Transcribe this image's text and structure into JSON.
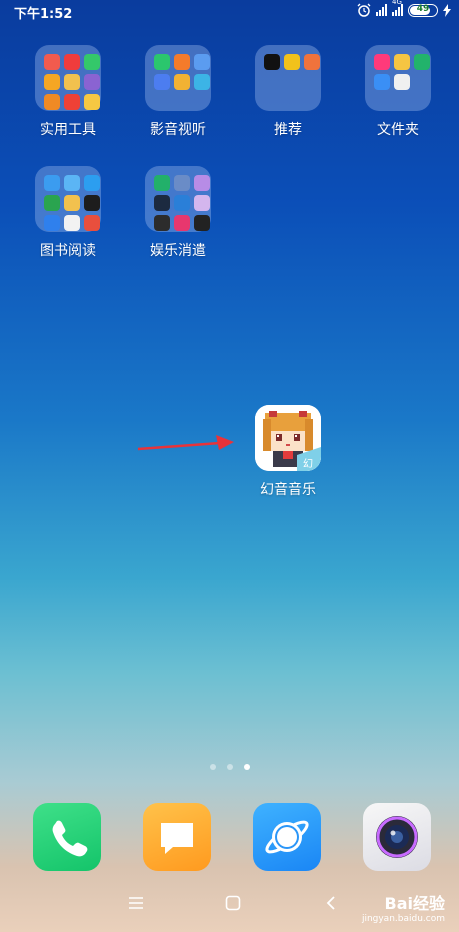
{
  "status_bar": {
    "time": "下午1:52",
    "battery": "49",
    "network": "4G"
  },
  "folders": [
    {
      "label": "实用工具",
      "colors": [
        "#f25b4e",
        "#f03c3c",
        "#34c86a",
        "#f5a623",
        "#f2c14e",
        "#8a63d2",
        "#f08a24",
        "#ef4136",
        "#f5c842"
      ]
    },
    {
      "label": "影音视听",
      "colors": [
        "#2bc66d",
        "#f47b2b",
        "#5b9cf0",
        "#4c7df0",
        "#f2b233",
        "#3cb4e6"
      ]
    },
    {
      "label": "推荐",
      "colors": [
        "#111111",
        "#f2c21b",
        "#f0733c"
      ]
    },
    {
      "label": "文件夹",
      "colors": [
        "#ff3a7a",
        "#f5c542",
        "#22b36b",
        "#3a8ff5",
        "#f0f0f0"
      ]
    },
    {
      "label": "图书阅读",
      "colors": [
        "#3b9cf0",
        "#5bb5f5",
        "#2c9ef0",
        "#2aa44f",
        "#f2c14e",
        "#1d1d1d",
        "#2f80ed",
        "#f2f2f2",
        "#e94f3d"
      ]
    },
    {
      "label": "娱乐消遣",
      "colors": [
        "#22b06a",
        "#6a8cc7",
        "#b78ce6",
        "#1c2a40",
        "#2a7fd8",
        "#d4b6ee",
        "#2c2c2c",
        "#e8376e",
        "#222222"
      ]
    }
  ],
  "app": {
    "label": "幻音音乐"
  },
  "dock": [
    {
      "name": "phone"
    },
    {
      "name": "messages"
    },
    {
      "name": "browser"
    },
    {
      "name": "camera"
    }
  ],
  "watermark": {
    "brand": "Bai经验",
    "url": "jingyan.baidu.com"
  }
}
